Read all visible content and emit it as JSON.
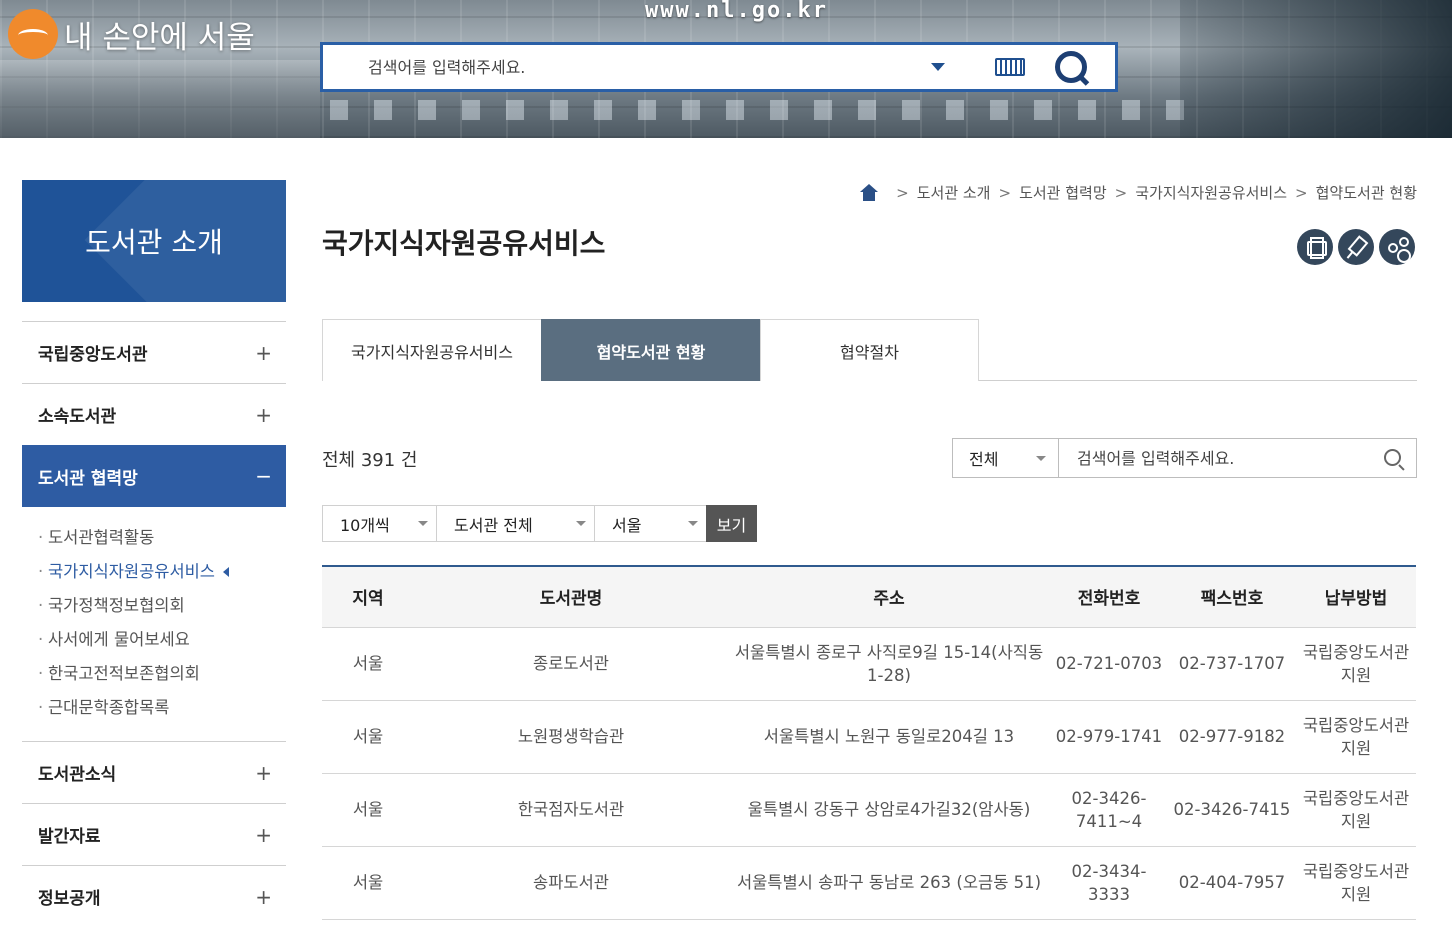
{
  "header": {
    "logo_text": "내 손안에 서울",
    "site_url": "www.nl.go.kr",
    "search_placeholder": "검색어를 입력해주세요."
  },
  "sidebar": {
    "title": "도서관 소개",
    "items": [
      {
        "label": "국립중앙도서관",
        "sign": "+"
      },
      {
        "label": "소속도서관",
        "sign": "+"
      },
      {
        "label": "도서관 협력망",
        "sign": "−"
      },
      {
        "label": "도서관소식",
        "sign": "+"
      },
      {
        "label": "발간자료",
        "sign": "+"
      },
      {
        "label": "정보공개",
        "sign": "+"
      }
    ],
    "submenu": [
      "도서관협력활동",
      "국가지식자원공유서비스",
      "국가정책정보협의회",
      "사서에게 물어보세요",
      "한국고전적보존협의회",
      "근대문학종합목록"
    ]
  },
  "breadcrumb": [
    "도서관 소개",
    "도서관 협력망",
    "국가지식자원공유서비스",
    "협약도서관 현황"
  ],
  "page_title": "국가지식자원공유서비스",
  "tabs": [
    "국가지식자원공유서비스",
    "협약도서관 현황",
    "협약절차"
  ],
  "total_text": "전체 391 건",
  "search": {
    "scope": "전체",
    "placeholder": "검색어를 입력해주세요."
  },
  "filters": {
    "per_page": "10개씩",
    "library_type": "도서관 전체",
    "region": "서울",
    "view_button": "보기"
  },
  "table": {
    "headers": [
      "지역",
      "도서관명",
      "주소",
      "전화번호",
      "팩스번호",
      "납부방법"
    ],
    "rows": [
      [
        "서울",
        "종로도서관",
        "서울특별시 종로구 사직로9길 15-14(사직동 1-28)",
        "02-721-0703",
        "02-737-1707",
        "국립중앙도서관 지원"
      ],
      [
        "서울",
        "노원평생학습관",
        "서울특별시 노원구 동일로204길 13",
        "02-979-1741",
        "02-977-9182",
        "국립중앙도서관 지원"
      ],
      [
        "서울",
        "한국점자도서관",
        "울특별시 강동구 상암로4가길32(암사동)",
        "02-3426-7411~4",
        "02-3426-7415",
        "국립중앙도서관 지원"
      ],
      [
        "서울",
        "송파도서관",
        "서울특별시 송파구 동남로 263 (오금동 51)",
        "02-3434-3333",
        "02-404-7957",
        "국립중앙도서관 지원"
      ]
    ]
  },
  "icons": {
    "home": "home-icon",
    "print": "print-icon",
    "pin": "pin-icon",
    "share": "share-icon",
    "search": "search-icon",
    "keyboard": "keyboard-icon"
  },
  "colors": {
    "brand_blue": "#1f5398",
    "active_menu": "#2e5ca3",
    "active_tab": "#5a6e80",
    "tool_button": "#34475b"
  }
}
